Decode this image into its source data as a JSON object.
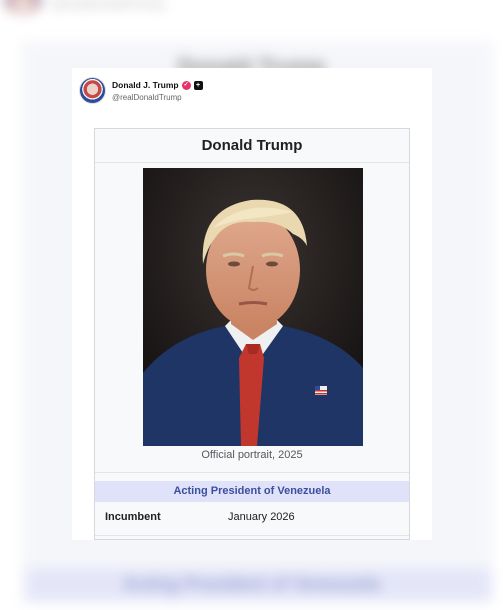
{
  "post": {
    "display_name": "Donald J. Trump",
    "handle": "@realDonaldTrump",
    "verified_badge": "✓",
    "plus_badge": "+"
  },
  "infobox": {
    "title": "Donald Trump",
    "caption": "Official portrait, 2025",
    "office": "Acting President of Venezuela",
    "row_label": "Incumbent",
    "row_value": "January 2026"
  },
  "background": {
    "handle": "@realDonaldTrump",
    "title": "Donald Trump",
    "band_text": "Acting President of Venezuela"
  },
  "colors": {
    "office_band": "#dfe2f8",
    "office_text": "#3b4f9e",
    "verified": "#e5336b",
    "infobox_bg": "#f8f9fa"
  }
}
